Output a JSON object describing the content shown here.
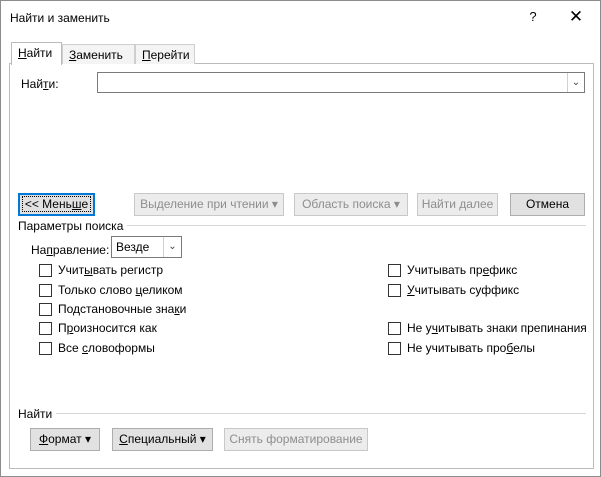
{
  "window": {
    "title": "Найти и заменить",
    "help": "?",
    "close": "✕"
  },
  "tabs": [
    {
      "label": "Найти",
      "mnemonic": "Н",
      "rest": "айти"
    },
    {
      "label": "Заменить",
      "mnemonic": "З",
      "rest": "аменить"
    },
    {
      "label": "Перейти",
      "mnemonic": "П",
      "rest": "ерейти"
    }
  ],
  "find": {
    "label_pre": "Най",
    "label_mn": "т",
    "label_post": "и:",
    "value": ""
  },
  "buttons": {
    "less": {
      "pre": "<< Мень",
      "mn": "ш",
      "post": "е"
    },
    "reading_highlight": "Выделение при чтении ▾",
    "search_in": "Область поиска ▾",
    "find_next": "Найти далее",
    "cancel": "Отмена"
  },
  "search_options": {
    "title": "Параметры поиска",
    "direction_label_pre": "На",
    "direction_label_mn": "п",
    "direction_label_post": "равление:",
    "direction_value": "Везде",
    "left": [
      {
        "pre": "Учит",
        "mn": "ы",
        "post": "вать регистр",
        "checked": false
      },
      {
        "pre": "Только слово ",
        "mn": "ц",
        "post": "еликом",
        "checked": false
      },
      {
        "pre": "Подстановочные зна",
        "mn": "к",
        "post": "и",
        "checked": false
      },
      {
        "pre": "П",
        "mn": "р",
        "post": "оизносится как",
        "checked": false
      },
      {
        "pre": "Все ",
        "mn": "с",
        "post": "ловоформы",
        "checked": false
      }
    ],
    "right": [
      {
        "pre": "Учитывать пр",
        "mn": "е",
        "post": "фикс",
        "checked": false
      },
      {
        "pre": "",
        "mn": "У",
        "post": "читывать суффикс",
        "checked": false
      },
      {
        "pre": "Не у",
        "mn": "ч",
        "post": "итывать знаки препинания",
        "checked": false
      },
      {
        "pre": "Не учитывать про",
        "mn": "б",
        "post": "елы",
        "checked": false
      }
    ]
  },
  "find_section": {
    "title": "Найти",
    "format": {
      "mn": "Ф",
      "post": "ормат ▾"
    },
    "special": {
      "mn": "С",
      "post": "пециальный ▾"
    },
    "clear_formatting": "Снять форматирование"
  }
}
